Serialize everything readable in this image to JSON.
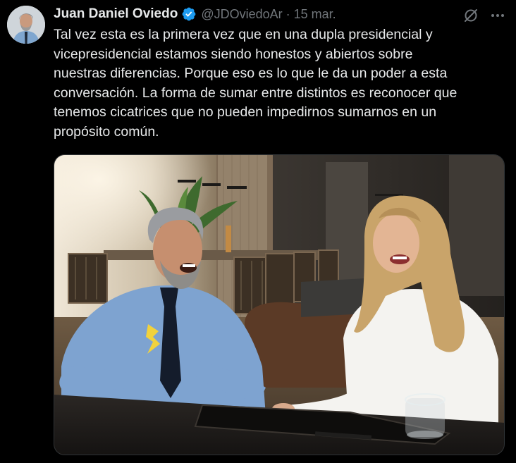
{
  "tweet": {
    "author": {
      "name": "Juan Daniel Oviedo",
      "handle": "@JDOviedoAr",
      "verified": true,
      "avatar_icon": "profile-photo"
    },
    "separator": "·",
    "date": "15 mar.",
    "text": "Tal vez esta es la primera vez que en una dupla presidencial y\nvicepresidencial estamos siendo honestos y abiertos sobre\nnuestras diferencias. Porque eso es lo que le da un poder a esta\nconversación. La forma de sumar entre distintos es reconocer que\ntenemos cicatrices que no pueden impedirnos sumarnos en un\npropósito común.",
    "media": {
      "type": "photo",
      "scene": "Two people laughing at a table in a dining room"
    },
    "icons": {
      "verified": "verified-badge-icon",
      "grok": "grok-icon",
      "more": "more-options-icon"
    }
  },
  "colors": {
    "background": "#000000",
    "primary_text": "#e7e9ea",
    "secondary_text": "#71767b",
    "verified_badge": "#1d9bf0",
    "border": "#2f3336"
  }
}
